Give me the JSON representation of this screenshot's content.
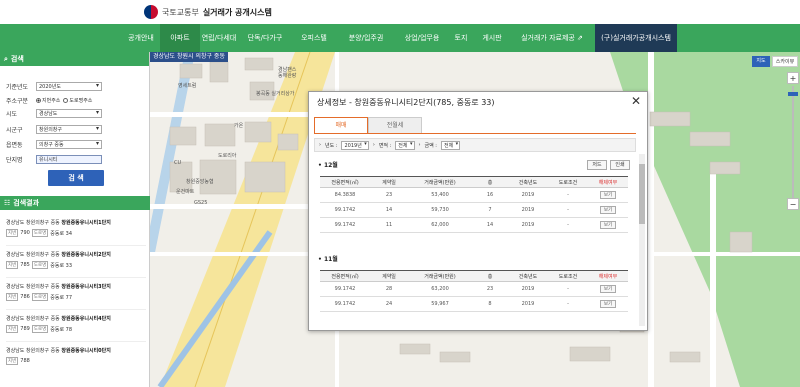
{
  "header": {
    "ministry": "국토교통부",
    "system": "실거래가 공개시스템"
  },
  "nav": {
    "items": [
      {
        "label": "공개안내",
        "state": "normal"
      },
      {
        "label": "아파트",
        "state": "active"
      },
      {
        "label": "연립/다세대",
        "state": "normal"
      },
      {
        "label": "단독/다가구",
        "state": "normal"
      },
      {
        "label": "오피스텔",
        "state": "normal"
      },
      {
        "label": "분양/입주권",
        "state": "normal"
      },
      {
        "label": "상업/업무용",
        "state": "normal"
      },
      {
        "label": "토지",
        "state": "normal"
      },
      {
        "label": "게시판",
        "state": "normal"
      },
      {
        "label": "실거래가 자료제공 ⇗",
        "state": "normal"
      },
      {
        "label": "(구)실거래가공개시스템",
        "state": "dark"
      }
    ]
  },
  "search_panel": {
    "title": "검색",
    "fields": {
      "year_label": "기준년도",
      "year_value": "2020년도",
      "addr_label": "주소구분",
      "addr_opt1": "지번주소",
      "addr_opt2": "도로명주소",
      "sido_label": "시도",
      "sido_value": "경상남도",
      "sigungu_label": "시군구",
      "sigungu_value": "창원의창구",
      "dong_label": "읍면동",
      "dong_value": "의창구 중동",
      "complex_label": "단지명",
      "complex_value": "유니시티"
    },
    "search_button": "검 색"
  },
  "results": {
    "title": "검색결과",
    "items": [
      {
        "addr": "경상남도 창원의창구 중동",
        "name": "창원중동유니시티1단지",
        "tag1": "지번",
        "num": "790",
        "tag2": "도로명",
        "road": "중동로 34"
      },
      {
        "addr": "경상남도 창원의창구 중동",
        "name": "창원중동유니시티2단지",
        "tag1": "지번",
        "num": "785",
        "tag2": "도로명",
        "road": "중동로 33"
      },
      {
        "addr": "경상남도 창원의창구 중동",
        "name": "창원중동유니시티3단지",
        "tag1": "지번",
        "num": "786",
        "tag2": "도로명",
        "road": "중동로 77"
      },
      {
        "addr": "경상남도 창원의창구 중동",
        "name": "창원중동유니시티4단지",
        "tag1": "지번",
        "num": "789",
        "tag2": "도로명",
        "road": "중동로 78"
      },
      {
        "addr": "경상남도 창원의창구 중동",
        "name": "창원중동유니시티0단지",
        "tag1": "지번",
        "num": "788",
        "tag2": "",
        "road": ""
      }
    ]
  },
  "map": {
    "region_label": "경상남도 창원시 의창구 중동",
    "map_type": "지도",
    "skyview": "스카이뷰",
    "zoom_in": "+",
    "zoom_out": "−",
    "labels": [
      "경남팬스",
      "동해완랑",
      "영세트럼",
      "봉곡동 실거리상가",
      "가온",
      "도로리아",
      "창원중앙농협",
      "CU",
      "운건마트",
      "GS25"
    ]
  },
  "modal": {
    "title": "상세정보 - 창원중동유니시티2단지(785, 중동로 33)",
    "close": "✕",
    "tab_sale": "매매",
    "tab_lease": "전월세",
    "filters": {
      "year_label": "년도 :",
      "year_value": "2019년",
      "area_label": "면적 :",
      "area_value": "전체",
      "price_label": "금액 :",
      "price_value": "전체"
    },
    "excel_btn": "저드",
    "print_btn": "인쇄",
    "columns": [
      "전용면적(㎡)",
      "계약일",
      "거래금액(만원)",
      "층",
      "건축년도",
      "도로조건",
      "해제여부"
    ],
    "months": [
      {
        "label": "12월",
        "rows": [
          {
            "area": "84.3838",
            "day": "23",
            "price": "53,400",
            "floor": "16",
            "built": "2019",
            "road": "-",
            "view": "보기"
          },
          {
            "area": "99.1742",
            "day": "14",
            "price": "59,730",
            "floor": "7",
            "built": "2019",
            "road": "-",
            "view": "보기"
          },
          {
            "area": "99.1742",
            "day": "11",
            "price": "62,000",
            "floor": "14",
            "built": "2019",
            "road": "-",
            "view": "보기"
          }
        ]
      },
      {
        "label": "11월",
        "rows": [
          {
            "area": "99.1742",
            "day": "28",
            "price": "63,200",
            "floor": "23",
            "built": "2019",
            "road": "-",
            "view": "보기"
          },
          {
            "area": "99.1742",
            "day": "24",
            "price": "59,967",
            "floor": "8",
            "built": "2019",
            "road": "-",
            "view": "보기"
          }
        ]
      }
    ]
  }
}
